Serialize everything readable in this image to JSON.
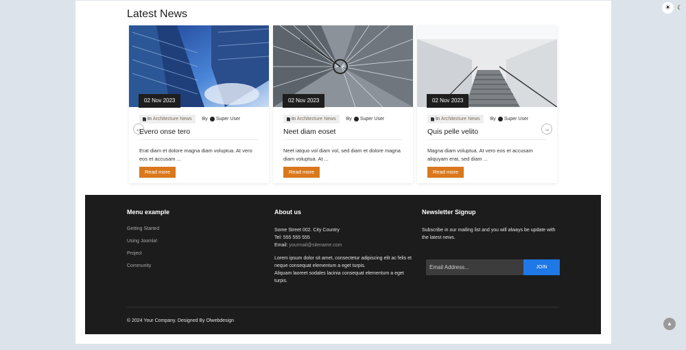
{
  "news": {
    "title": "Latest News",
    "cards": [
      {
        "date": "02 Nov 2023",
        "category_prefix": "In",
        "category": "Architecture News",
        "author_prefix": "By",
        "author": "Super User",
        "title": "Evero onse tero",
        "text": "Erat diam et dolore magna diam voluptua. At vero eos et accusam ...",
        "read_more": "Read more"
      },
      {
        "date": "02 Nov 2023",
        "category_prefix": "In",
        "category": "Architecture News",
        "author_prefix": "By",
        "author": "Super User",
        "title": "Neet diam eoset",
        "text": "Neet iatquo vol diam vol, sed diam et dolore magna diam voluptua. At ...",
        "read_more": "Read more"
      },
      {
        "date": "02 Nov 2023",
        "category_prefix": "In",
        "category": "Architecture News",
        "author_prefix": "By",
        "author": "Super User",
        "title": "Quis pelle velito",
        "text": "Magna diam voluptua. At vero eos et accusam aliquyam erat, sed diam ...",
        "read_more": "Read more"
      }
    ],
    "prev_icon": "arrow-left-icon",
    "next_icon": "arrow-right-icon"
  },
  "footer": {
    "menu": {
      "title": "Menu example",
      "items": [
        "Getting Started",
        "Using Joomla!",
        "Project",
        "Community"
      ]
    },
    "about": {
      "title": "About us",
      "address": "Some Street 002. City Country",
      "tel": "Tel: 555 555 555",
      "email_label": "Email:",
      "email": "yourmail@sitename.com",
      "para1": "Lorem ipsum dolor sit amet, consectetur adipiscing elit ac felis et neque consequat elementum a eget turpis.",
      "para2": "Aliquam laoreet sodales lacinia consequat elementum a eget turpis."
    },
    "newsletter": {
      "title": "Newsletter Signup",
      "text": "Subscribe in our mailing list and you will always be update with the latest news.",
      "placeholder": "Email Address...",
      "button": "JOIN"
    },
    "copyright": "© 2024 Your Company. Designed By Olwebdesign"
  },
  "controls": {
    "theme_light_icon": "sun-icon",
    "theme_dark_icon": "moon-icon",
    "back_to_top_icon": "chevron-up-icon"
  },
  "colors": {
    "accent": "#d9781c",
    "footer_bg": "#1c1c1c",
    "join_button": "#1e78e6",
    "page_bg": "#dde3ea"
  }
}
